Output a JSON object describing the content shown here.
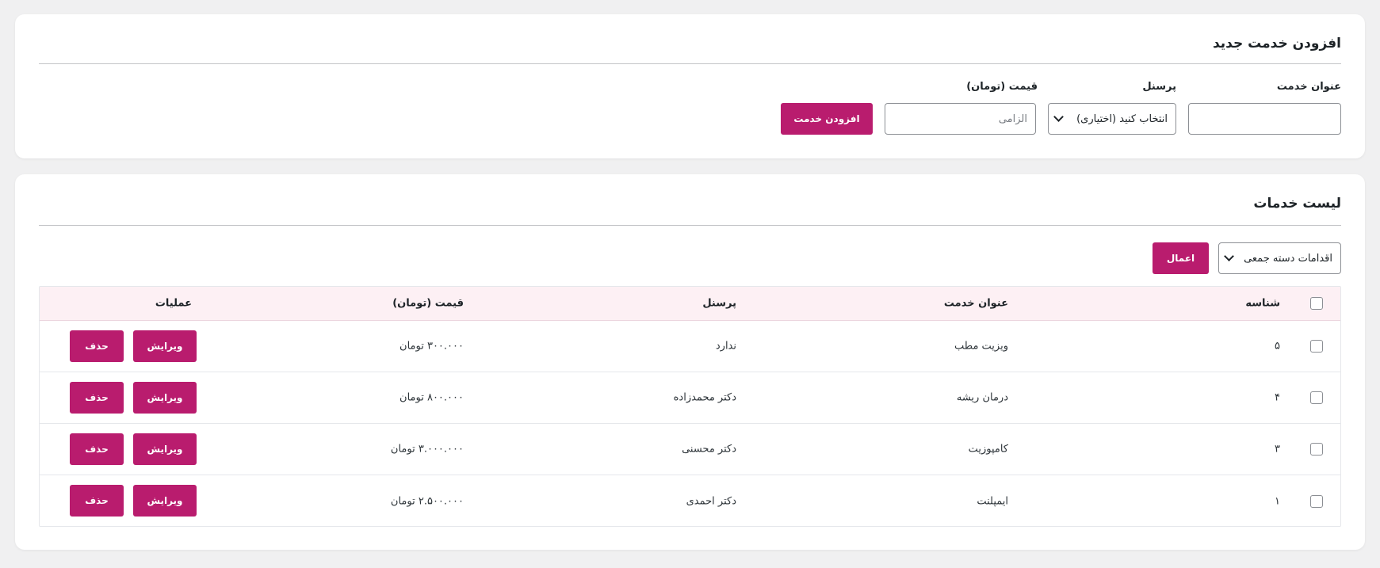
{
  "add_form": {
    "title": "افزودن خدمت جدید",
    "service_title_label": "عنوان خدمت",
    "service_title_value": "",
    "staff_label": "پرسنل",
    "staff_select_value": "انتخاب کنید (اختیاری)",
    "price_label": "قیمت (تومان)",
    "price_placeholder": "الزامی",
    "submit_label": "افزودن خدمت"
  },
  "list": {
    "title": "لیست خدمات",
    "bulk_actions_value": "اقدامات دسته جمعی",
    "apply_label": "اعمال",
    "columns": {
      "id": "شناسه",
      "title": "عنوان خدمت",
      "staff": "پرسنل",
      "price": "قیمت (تومان)",
      "operations": "عملیات"
    },
    "edit_label": "ویرایش",
    "delete_label": "حذف",
    "rows": [
      {
        "id": "۵",
        "title": "ویزیت مطب",
        "staff": "ندارد",
        "price": "۳۰۰.۰۰۰ تومان"
      },
      {
        "id": "۴",
        "title": "درمان ریشه",
        "staff": "دکتر محمدزاده",
        "price": "۸۰۰.۰۰۰ تومان"
      },
      {
        "id": "۳",
        "title": "کامپوزیت",
        "staff": "دکتر محسنی",
        "price": "۳.۰۰۰.۰۰۰ تومان"
      },
      {
        "id": "۱",
        "title": "ایمپلنت",
        "staff": "دکتر احمدی",
        "price": "۲.۵۰۰.۰۰۰ تومان"
      }
    ]
  },
  "colors": {
    "accent": "#b91c6e",
    "table_header_bg": "#fdf0f4",
    "page_bg": "#f0f0f1"
  }
}
